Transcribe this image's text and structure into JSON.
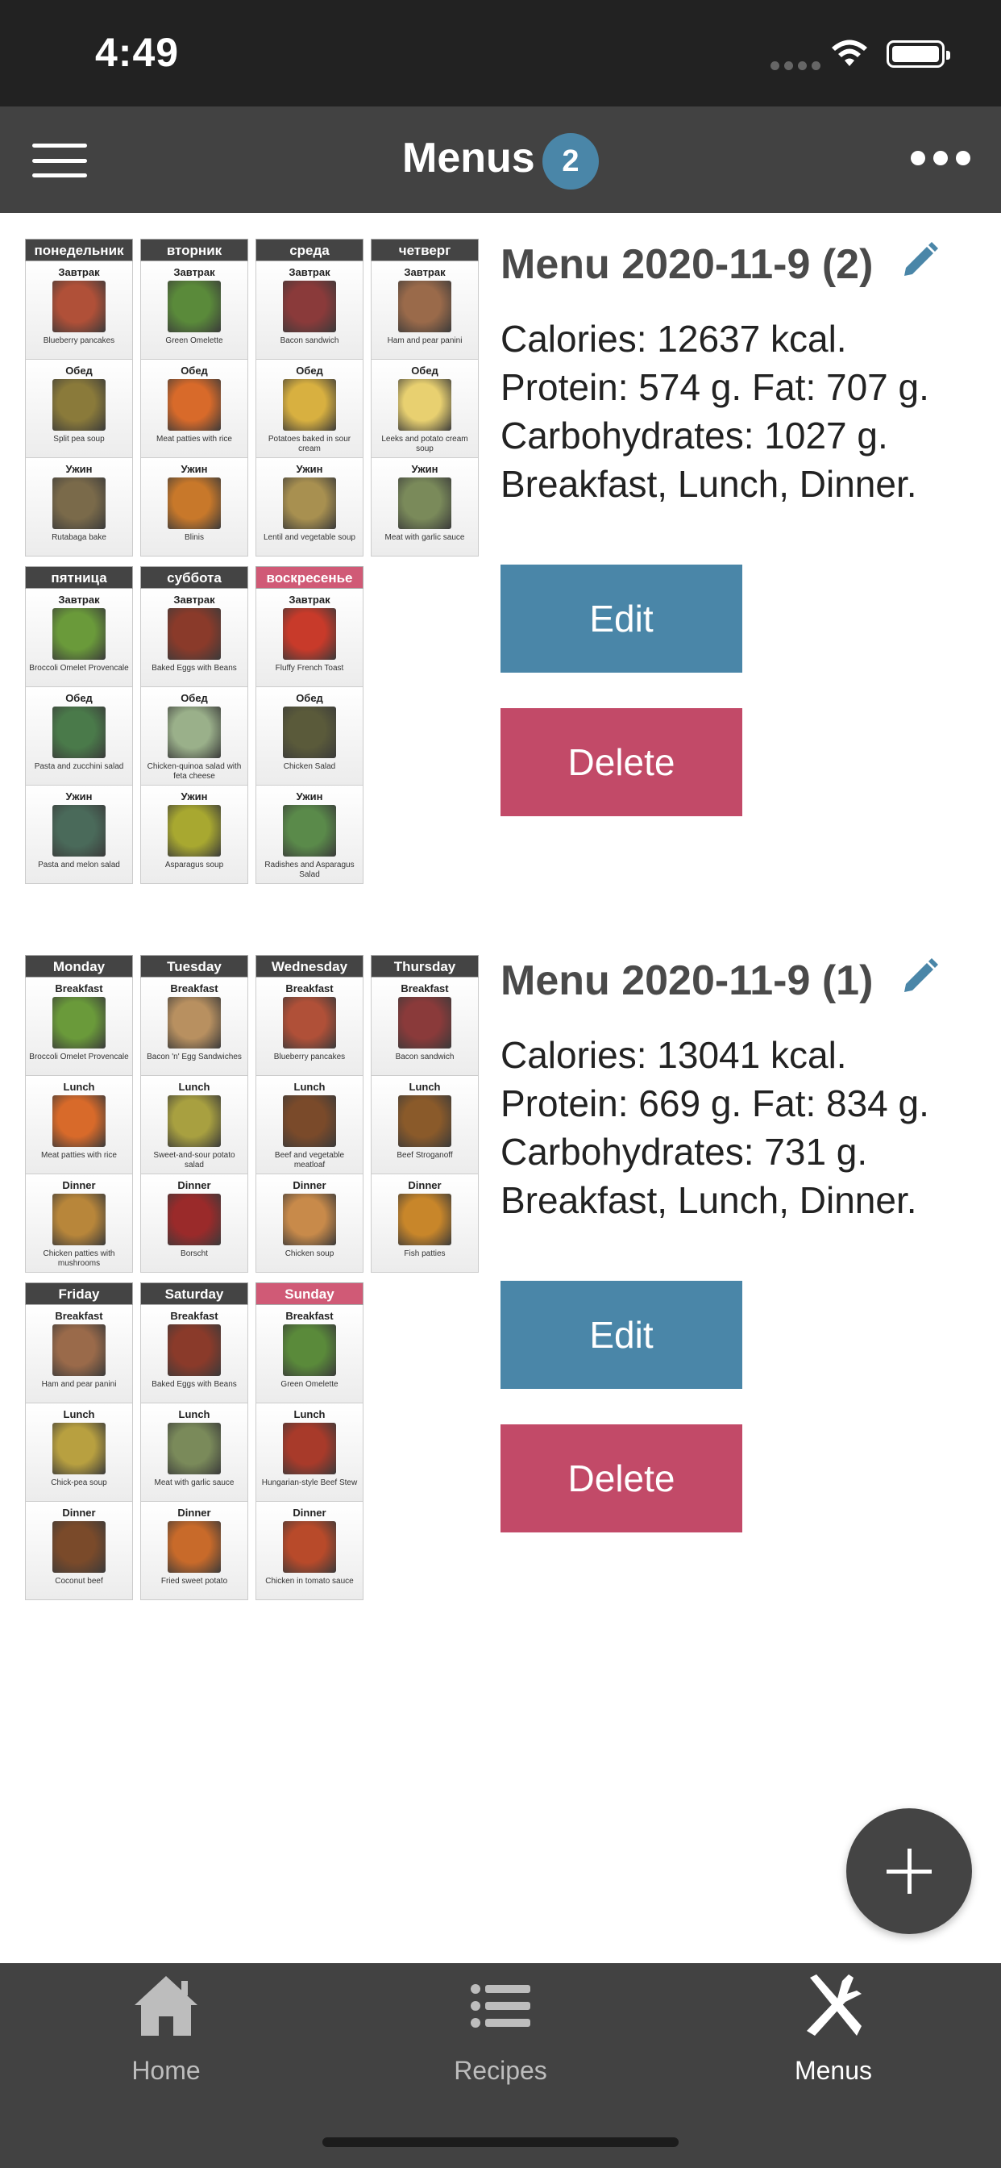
{
  "status_bar": {
    "time": "4:49"
  },
  "nav": {
    "title": "Menus",
    "badge": "2"
  },
  "menus": [
    {
      "title": "Menu 2020-11-9 (2)",
      "stats": [
        "Calories: 12637 kcal.",
        "Protein: 574 g. Fat: 707 g.",
        "Carbohydrates: 1027 g.",
        "Breakfast, Lunch, Dinner."
      ],
      "edit_label": "Edit",
      "delete_label": "Delete",
      "days": [
        {
          "name": "понедельник",
          "sunday": false,
          "meals": [
            {
              "type": "Завтрак",
              "name": "Blueberry pancakes",
              "color": "#b05038"
            },
            {
              "type": "Обед",
              "name": "Split pea soup",
              "color": "#8a7a3a"
            },
            {
              "type": "Ужин",
              "name": "Rutabaga bake",
              "color": "#7a6a4a"
            }
          ]
        },
        {
          "name": "вторник",
          "sunday": false,
          "meals": [
            {
              "type": "Завтрак",
              "name": "Green Omelette",
              "color": "#5a8a3a"
            },
            {
              "type": "Обед",
              "name": "Meat patties with rice",
              "color": "#d86a2a"
            },
            {
              "type": "Ужин",
              "name": "Blinis",
              "color": "#c8782a"
            }
          ]
        },
        {
          "name": "среда",
          "sunday": false,
          "meals": [
            {
              "type": "Завтрак",
              "name": "Bacon sandwich",
              "color": "#8a3a3a"
            },
            {
              "type": "Обед",
              "name": "Potatoes baked in sour cream",
              "color": "#d8b040"
            },
            {
              "type": "Ужин",
              "name": "Lentil and vegetable soup",
              "color": "#a89050"
            }
          ]
        },
        {
          "name": "четверг",
          "sunday": false,
          "meals": [
            {
              "type": "Завтрак",
              "name": "Ham and pear panini",
              "color": "#9a6a4a"
            },
            {
              "type": "Обед",
              "name": "Leeks and potato cream soup",
              "color": "#e8d070"
            },
            {
              "type": "Ужин",
              "name": "Meat with garlic sauce",
              "color": "#7a8a5a"
            }
          ]
        },
        {
          "name": "пятница",
          "sunday": false,
          "meals": [
            {
              "type": "Завтрак",
              "name": "Broccoli Omelet Provencale",
              "color": "#6a9a3a"
            },
            {
              "type": "Обед",
              "name": "Pasta and zucchini salad",
              "color": "#4a7a4a"
            },
            {
              "type": "Ужин",
              "name": "Pasta and melon salad",
              "color": "#4a6a5a"
            }
          ]
        },
        {
          "name": "суббота",
          "sunday": false,
          "meals": [
            {
              "type": "Завтрак",
              "name": "Baked Eggs with Beans",
              "color": "#8a3a2a"
            },
            {
              "type": "Обед",
              "name": "Chicken-quinoa salad with feta cheese",
              "color": "#9ab08a"
            },
            {
              "type": "Ужин",
              "name": "Asparagus soup",
              "color": "#a8a830"
            }
          ]
        },
        {
          "name": "воскресенье",
          "sunday": true,
          "meals": [
            {
              "type": "Завтрак",
              "name": "Fluffy French Toast",
              "color": "#c83a2a"
            },
            {
              "type": "Обед",
              "name": "Chicken Salad",
              "color": "#5a5a3a"
            },
            {
              "type": "Ужин",
              "name": "Radishes and Asparagus Salad",
              "color": "#5a8a4a"
            }
          ]
        }
      ]
    },
    {
      "title": "Menu 2020-11-9 (1)",
      "stats": [
        "Calories: 13041 kcal.",
        "Protein: 669 g. Fat: 834 g.",
        "Carbohydrates: 731 g.",
        "Breakfast, Lunch, Dinner."
      ],
      "edit_label": "Edit",
      "delete_label": "Delete",
      "days": [
        {
          "name": "Monday",
          "sunday": false,
          "meals": [
            {
              "type": "Breakfast",
              "name": "Broccoli Omelet Provencale",
              "color": "#6a9a3a"
            },
            {
              "type": "Lunch",
              "name": "Meat patties with rice",
              "color": "#d86a2a"
            },
            {
              "type": "Dinner",
              "name": "Chicken patties with mushrooms",
              "color": "#b8863a"
            }
          ]
        },
        {
          "name": "Tuesday",
          "sunday": false,
          "meals": [
            {
              "type": "Breakfast",
              "name": "Bacon 'n' Egg Sandwiches",
              "color": "#b89060"
            },
            {
              "type": "Lunch",
              "name": "Sweet-and-sour potato salad",
              "color": "#a8a040"
            },
            {
              "type": "Dinner",
              "name": "Borscht",
              "color": "#9a2a2a"
            }
          ]
        },
        {
          "name": "Wednesday",
          "sunday": false,
          "meals": [
            {
              "type": "Breakfast",
              "name": "Blueberry pancakes",
              "color": "#b05038"
            },
            {
              "type": "Lunch",
              "name": "Beef and vegetable meatloaf",
              "color": "#7a4a2a"
            },
            {
              "type": "Dinner",
              "name": "Chicken soup",
              "color": "#c88a4a"
            }
          ]
        },
        {
          "name": "Thursday",
          "sunday": false,
          "meals": [
            {
              "type": "Breakfast",
              "name": "Bacon sandwich",
              "color": "#8a3a3a"
            },
            {
              "type": "Lunch",
              "name": "Beef Stroganoff",
              "color": "#8a5a2a"
            },
            {
              "type": "Dinner",
              "name": "Fish patties",
              "color": "#c8862a"
            }
          ]
        },
        {
          "name": "Friday",
          "sunday": false,
          "meals": [
            {
              "type": "Breakfast",
              "name": "Ham and pear panini",
              "color": "#9a6a4a"
            },
            {
              "type": "Lunch",
              "name": "Chick-pea soup",
              "color": "#b8a040"
            },
            {
              "type": "Dinner",
              "name": "Coconut beef",
              "color": "#7a4a2a"
            }
          ]
        },
        {
          "name": "Saturday",
          "sunday": false,
          "meals": [
            {
              "type": "Breakfast",
              "name": "Baked Eggs with Beans",
              "color": "#8a3a2a"
            },
            {
              "type": "Lunch",
              "name": "Meat with garlic sauce",
              "color": "#7a8a5a"
            },
            {
              "type": "Dinner",
              "name": "Fried sweet potato",
              "color": "#c86a2a"
            }
          ]
        },
        {
          "name": "Sunday",
          "sunday": true,
          "meals": [
            {
              "type": "Breakfast",
              "name": "Green Omelette",
              "color": "#5a8a3a"
            },
            {
              "type": "Lunch",
              "name": "Hungarian-style Beef Stew",
              "color": "#a83a2a"
            },
            {
              "type": "Dinner",
              "name": "Chicken in tomato sauce",
              "color": "#b84a2a"
            }
          ]
        }
      ]
    }
  ],
  "tabs": [
    {
      "label": "Home",
      "icon": "home-icon",
      "active": false
    },
    {
      "label": "Recipes",
      "icon": "list-icon",
      "active": false
    },
    {
      "label": "Menus",
      "icon": "fork-knife-icon",
      "active": true
    }
  ],
  "colors": {
    "accent": "#4a86a8",
    "danger": "#c24a68",
    "bar": "#424242",
    "sunday": "#d05a76"
  }
}
